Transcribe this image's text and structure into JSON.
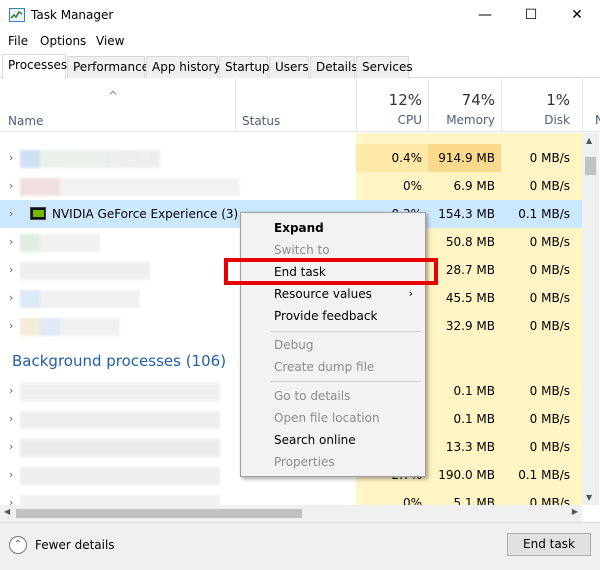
{
  "window": {
    "title": "Task Manager",
    "minimize_glyph": "—",
    "maximize_glyph": "☐",
    "close_glyph": "✕"
  },
  "menu": {
    "file": "File",
    "options": "Options",
    "view": "View"
  },
  "tabs": [
    "Processes",
    "Performance",
    "App history",
    "Startup",
    "Users",
    "Details",
    "Services"
  ],
  "header": {
    "name": "Name",
    "status": "Status",
    "cpu_pct": "12%",
    "cpu_label": "CPU",
    "mem_pct": "74%",
    "mem_label": "Memory",
    "disk_pct": "1%",
    "disk_label": "Disk",
    "next_col_label": "N"
  },
  "rows": [
    {
      "cpu": "",
      "mem": "",
      "disk": ""
    },
    {
      "cpu": "0.4%",
      "mem": "914.9 MB",
      "disk": "0 MB/s"
    },
    {
      "cpu": "0%",
      "mem": "6.9 MB",
      "disk": "0 MB/s"
    },
    {
      "name": "NVIDIA GeForce Experience (3)",
      "cpu": "0.3%",
      "mem": "154.3 MB",
      "disk": "0.1 MB/s"
    },
    {
      "cpu": "",
      "mem": "50.8 MB",
      "disk": "0 MB/s"
    },
    {
      "cpu": "",
      "mem": "28.7 MB",
      "disk": "0 MB/s"
    },
    {
      "cpu": "",
      "mem": "45.5 MB",
      "disk": "0 MB/s"
    },
    {
      "cpu": "",
      "mem": "32.9 MB",
      "disk": "0 MB/s"
    }
  ],
  "background_group": "Background processes (106)",
  "bg_rows": [
    {
      "cpu": "",
      "mem": "0.1 MB",
      "disk": "0 MB/s"
    },
    {
      "cpu": "",
      "mem": "0.1 MB",
      "disk": "0 MB/s"
    },
    {
      "cpu": "",
      "mem": "13.3 MB",
      "disk": "0 MB/s"
    },
    {
      "cpu": "2.7%",
      "mem": "190.0 MB",
      "disk": "0.1 MB/s"
    },
    {
      "cpu": "0%",
      "mem": "5.1 MB",
      "disk": "0 MB/s"
    }
  ],
  "context_menu": {
    "expand": "Expand",
    "switch_to": "Switch to",
    "end_task": "End task",
    "resource_values": "Resource values",
    "provide_feedback": "Provide feedback",
    "debug": "Debug",
    "create_dump_file": "Create dump file",
    "go_to_details": "Go to details",
    "open_file_location": "Open file location",
    "search_online": "Search online",
    "properties": "Properties"
  },
  "footer": {
    "fewer_details": "Fewer details",
    "end_task": "End task"
  },
  "colors": {
    "highlight": "#e60000",
    "selected_row": "#cce8ff",
    "heat": "#fff4c4",
    "group_label": "#1f5fa8"
  },
  "icons": {
    "app": "task-manager-icon",
    "nvidia": "nvidia-icon",
    "chevron": "chevron-right-icon"
  }
}
